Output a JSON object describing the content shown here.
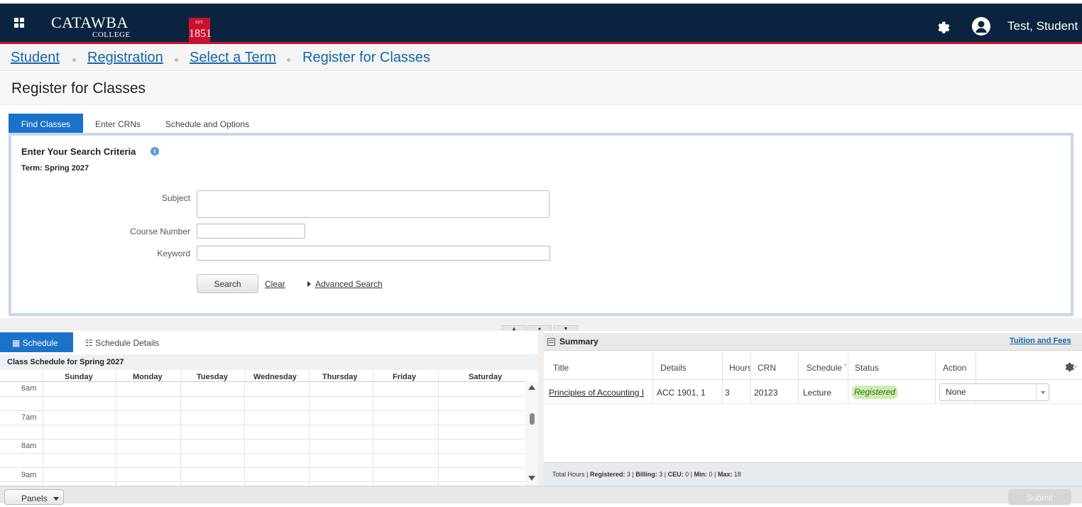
{
  "header": {
    "logo_name": "CATAWBA",
    "logo_sub": "COLLEGE",
    "logo_est": "EST.",
    "logo_year": "1851",
    "user_name": "Test, Student",
    "colors": {
      "navy": "#0c2340",
      "red": "#c8102e"
    },
    "icons": [
      "grid-menu-icon",
      "gear-icon",
      "user-avatar-icon"
    ]
  },
  "breadcrumb": [
    "Student",
    "Registration",
    "Select a Term",
    "Register for Classes"
  ],
  "page_title": "Register for Classes",
  "tabs": [
    "Find Classes",
    "Enter CRNs",
    "Schedule and Options"
  ],
  "search": {
    "heading": "Enter Your Search Criteria",
    "term": "Term: Spring 2027",
    "subject_label": "Subject",
    "course_label": "Course Number",
    "keyword_label": "Keyword",
    "search_button": "Search",
    "clear_link": "Clear",
    "advanced_link": "Advanced Search"
  },
  "schedule": {
    "tab_schedule": "Schedule",
    "tab_details": "Schedule Details",
    "title": "Class Schedule for Spring 2027",
    "days": [
      "Sunday",
      "Monday",
      "Tuesday",
      "Wednesday",
      "Thursday",
      "Friday",
      "Saturday"
    ],
    "hours": [
      "6am",
      "7am",
      "8am",
      "9am"
    ]
  },
  "summary": {
    "title": "Summary",
    "tuition_link": "Tuition and Fees",
    "columns": [
      "Title",
      "Details",
      "Hours",
      "CRN",
      "Schedule Type",
      "Status",
      "Action"
    ],
    "rows": [
      {
        "title": "Principles of Accounting I",
        "details": "ACC 1901, 1",
        "hours": "3",
        "crn": "20123",
        "schedule_type": "Lecture",
        "status": "Registered",
        "action": "None"
      }
    ],
    "totals": {
      "prefix": "Total Hours |",
      "registered_label": "Registered:",
      "registered": "3",
      "billing_label": "Billing:",
      "billing": "3",
      "ceu_label": "CEU:",
      "ceu": "0",
      "min_label": "Min:",
      "min": "0",
      "max_label": "Max:",
      "max": "18"
    }
  },
  "footer": {
    "panels_button": "Panels",
    "submit_button": "Submit"
  }
}
